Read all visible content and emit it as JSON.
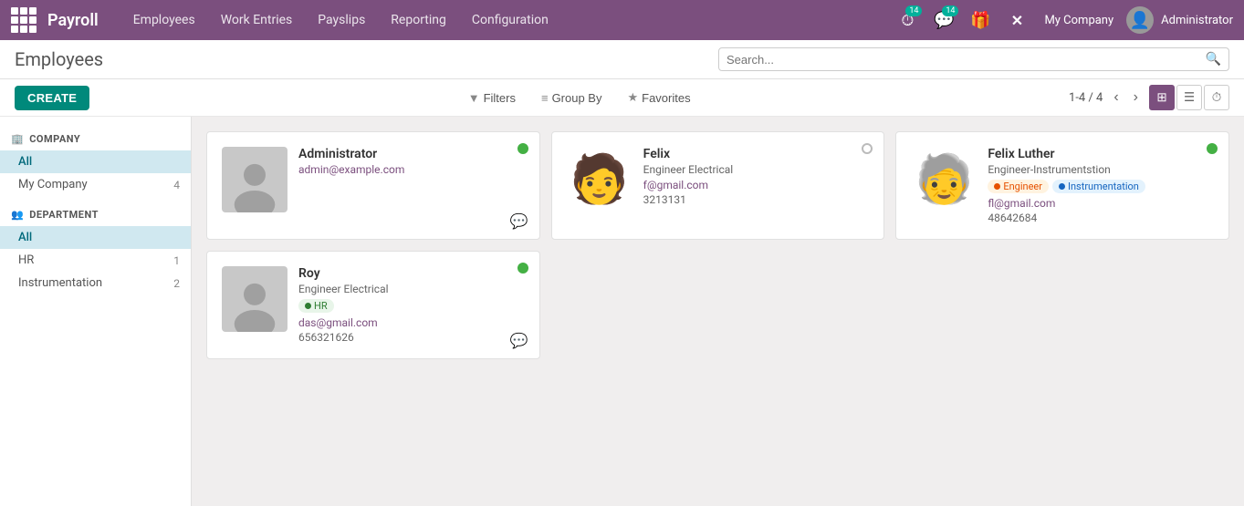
{
  "app": {
    "name": "Payroll"
  },
  "topnav": {
    "links": [
      {
        "id": "employees",
        "label": "Employees"
      },
      {
        "id": "work-entries",
        "label": "Work Entries"
      },
      {
        "id": "payslips",
        "label": "Payslips"
      },
      {
        "id": "reporting",
        "label": "Reporting"
      },
      {
        "id": "configuration",
        "label": "Configuration"
      }
    ],
    "notifications_count_1": "14",
    "notifications_count_2": "14",
    "company": "My Company",
    "username": "Administrator"
  },
  "page": {
    "title": "Employees",
    "create_label": "CREATE"
  },
  "search": {
    "placeholder": "Search..."
  },
  "filters": {
    "filters_label": "Filters",
    "group_by_label": "Group By",
    "favorites_label": "Favorites"
  },
  "pagination": {
    "current": "1-4 / 4"
  },
  "sidebar": {
    "company_section": "COMPANY",
    "company_items": [
      {
        "id": "all-company",
        "label": "All",
        "count": "",
        "active": true
      },
      {
        "id": "my-company",
        "label": "My Company",
        "count": "4"
      }
    ],
    "department_section": "DEPARTMENT",
    "department_items": [
      {
        "id": "all-dept",
        "label": "All",
        "count": "",
        "active": true
      },
      {
        "id": "hr",
        "label": "HR",
        "count": "1"
      },
      {
        "id": "instrumentation",
        "label": "Instrumentation",
        "count": "2"
      }
    ]
  },
  "employees": [
    {
      "id": "admin",
      "name": "Administrator",
      "title": "",
      "email": "admin@example.com",
      "phone": "",
      "status": "online",
      "has_chat": true,
      "tags": [],
      "avatar_type": "placeholder"
    },
    {
      "id": "felix",
      "name": "Felix",
      "title": "Engineer Electrical",
      "email": "f@gmail.com",
      "phone": "3213131",
      "status": "offline",
      "has_chat": false,
      "tags": [],
      "avatar_type": "emoji",
      "avatar_emoji": "👦"
    },
    {
      "id": "felix-luther",
      "name": "Felix Luther",
      "title": "Engineer-Instrumentstion",
      "email": "fl@gmail.com",
      "phone": "48642684",
      "status": "online",
      "has_chat": false,
      "tags": [
        {
          "label": "Engineer",
          "type": "orange"
        },
        {
          "label": "Instrumentation",
          "type": "blue"
        }
      ],
      "avatar_type": "emoji",
      "avatar_emoji": "🧑‍🦳"
    },
    {
      "id": "roy",
      "name": "Roy",
      "title": "Engineer Electrical",
      "email": "das@gmail.com",
      "phone": "656321626",
      "status": "online",
      "has_chat": true,
      "tags": [
        {
          "label": "HR",
          "type": "green"
        }
      ],
      "avatar_type": "placeholder"
    }
  ],
  "icons": {
    "grid": "⊞",
    "list": "☰",
    "clock": "⏱",
    "filter": "▼",
    "star": "★",
    "chevron_left": "‹",
    "chevron_right": "›"
  }
}
